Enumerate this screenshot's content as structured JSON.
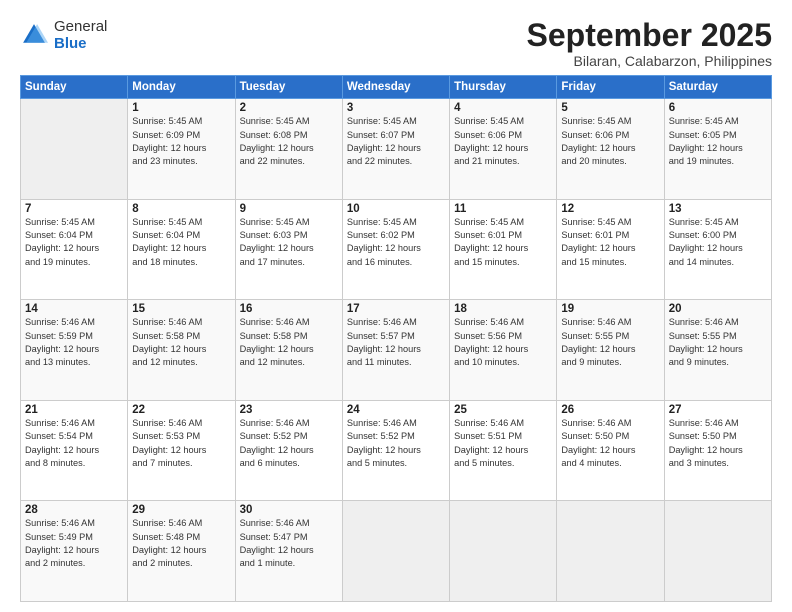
{
  "header": {
    "logo_general": "General",
    "logo_blue": "Blue",
    "month_title": "September 2025",
    "subtitle": "Bilaran, Calabarzon, Philippines"
  },
  "weekdays": [
    "Sunday",
    "Monday",
    "Tuesday",
    "Wednesday",
    "Thursday",
    "Friday",
    "Saturday"
  ],
  "weeks": [
    [
      {
        "day": "",
        "info": ""
      },
      {
        "day": "1",
        "info": "Sunrise: 5:45 AM\nSunset: 6:09 PM\nDaylight: 12 hours\nand 23 minutes."
      },
      {
        "day": "2",
        "info": "Sunrise: 5:45 AM\nSunset: 6:08 PM\nDaylight: 12 hours\nand 22 minutes."
      },
      {
        "day": "3",
        "info": "Sunrise: 5:45 AM\nSunset: 6:07 PM\nDaylight: 12 hours\nand 22 minutes."
      },
      {
        "day": "4",
        "info": "Sunrise: 5:45 AM\nSunset: 6:06 PM\nDaylight: 12 hours\nand 21 minutes."
      },
      {
        "day": "5",
        "info": "Sunrise: 5:45 AM\nSunset: 6:06 PM\nDaylight: 12 hours\nand 20 minutes."
      },
      {
        "day": "6",
        "info": "Sunrise: 5:45 AM\nSunset: 6:05 PM\nDaylight: 12 hours\nand 19 minutes."
      }
    ],
    [
      {
        "day": "7",
        "info": "Sunrise: 5:45 AM\nSunset: 6:04 PM\nDaylight: 12 hours\nand 19 minutes."
      },
      {
        "day": "8",
        "info": "Sunrise: 5:45 AM\nSunset: 6:04 PM\nDaylight: 12 hours\nand 18 minutes."
      },
      {
        "day": "9",
        "info": "Sunrise: 5:45 AM\nSunset: 6:03 PM\nDaylight: 12 hours\nand 17 minutes."
      },
      {
        "day": "10",
        "info": "Sunrise: 5:45 AM\nSunset: 6:02 PM\nDaylight: 12 hours\nand 16 minutes."
      },
      {
        "day": "11",
        "info": "Sunrise: 5:45 AM\nSunset: 6:01 PM\nDaylight: 12 hours\nand 15 minutes."
      },
      {
        "day": "12",
        "info": "Sunrise: 5:45 AM\nSunset: 6:01 PM\nDaylight: 12 hours\nand 15 minutes."
      },
      {
        "day": "13",
        "info": "Sunrise: 5:45 AM\nSunset: 6:00 PM\nDaylight: 12 hours\nand 14 minutes."
      }
    ],
    [
      {
        "day": "14",
        "info": "Sunrise: 5:46 AM\nSunset: 5:59 PM\nDaylight: 12 hours\nand 13 minutes."
      },
      {
        "day": "15",
        "info": "Sunrise: 5:46 AM\nSunset: 5:58 PM\nDaylight: 12 hours\nand 12 minutes."
      },
      {
        "day": "16",
        "info": "Sunrise: 5:46 AM\nSunset: 5:58 PM\nDaylight: 12 hours\nand 12 minutes."
      },
      {
        "day": "17",
        "info": "Sunrise: 5:46 AM\nSunset: 5:57 PM\nDaylight: 12 hours\nand 11 minutes."
      },
      {
        "day": "18",
        "info": "Sunrise: 5:46 AM\nSunset: 5:56 PM\nDaylight: 12 hours\nand 10 minutes."
      },
      {
        "day": "19",
        "info": "Sunrise: 5:46 AM\nSunset: 5:55 PM\nDaylight: 12 hours\nand 9 minutes."
      },
      {
        "day": "20",
        "info": "Sunrise: 5:46 AM\nSunset: 5:55 PM\nDaylight: 12 hours\nand 9 minutes."
      }
    ],
    [
      {
        "day": "21",
        "info": "Sunrise: 5:46 AM\nSunset: 5:54 PM\nDaylight: 12 hours\nand 8 minutes."
      },
      {
        "day": "22",
        "info": "Sunrise: 5:46 AM\nSunset: 5:53 PM\nDaylight: 12 hours\nand 7 minutes."
      },
      {
        "day": "23",
        "info": "Sunrise: 5:46 AM\nSunset: 5:52 PM\nDaylight: 12 hours\nand 6 minutes."
      },
      {
        "day": "24",
        "info": "Sunrise: 5:46 AM\nSunset: 5:52 PM\nDaylight: 12 hours\nand 5 minutes."
      },
      {
        "day": "25",
        "info": "Sunrise: 5:46 AM\nSunset: 5:51 PM\nDaylight: 12 hours\nand 5 minutes."
      },
      {
        "day": "26",
        "info": "Sunrise: 5:46 AM\nSunset: 5:50 PM\nDaylight: 12 hours\nand 4 minutes."
      },
      {
        "day": "27",
        "info": "Sunrise: 5:46 AM\nSunset: 5:50 PM\nDaylight: 12 hours\nand 3 minutes."
      }
    ],
    [
      {
        "day": "28",
        "info": "Sunrise: 5:46 AM\nSunset: 5:49 PM\nDaylight: 12 hours\nand 2 minutes."
      },
      {
        "day": "29",
        "info": "Sunrise: 5:46 AM\nSunset: 5:48 PM\nDaylight: 12 hours\nand 2 minutes."
      },
      {
        "day": "30",
        "info": "Sunrise: 5:46 AM\nSunset: 5:47 PM\nDaylight: 12 hours\nand 1 minute."
      },
      {
        "day": "",
        "info": ""
      },
      {
        "day": "",
        "info": ""
      },
      {
        "day": "",
        "info": ""
      },
      {
        "day": "",
        "info": ""
      }
    ]
  ]
}
